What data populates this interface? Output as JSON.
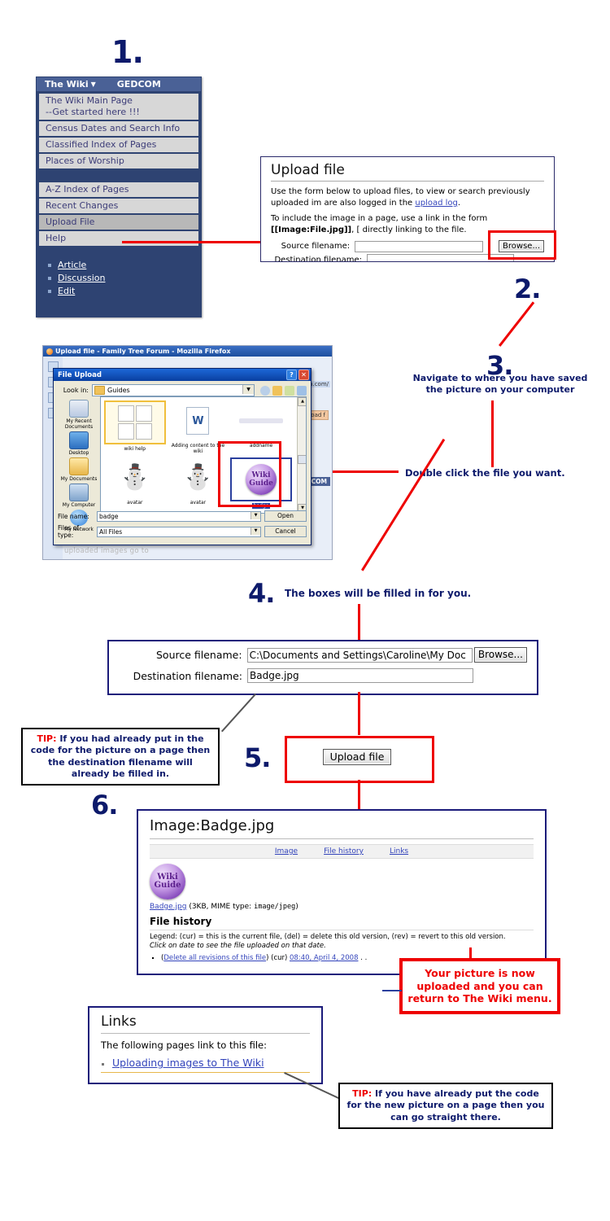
{
  "steps": {
    "one": "1.",
    "two": "2.",
    "three": "3.",
    "four": "4.",
    "five": "5.",
    "six": "6."
  },
  "annotations": {
    "navigate": "Navigate to where you have saved\nthe picture on your computer",
    "double_click": "Double click the file you want.",
    "boxes_filled": "The boxes will be filled in for you."
  },
  "wiki_menu": {
    "header_title": "The Wiki",
    "header_caret": "▼",
    "header_right": "GEDCOM",
    "items": [
      {
        "label": "The Wiki Main Page\n--Get started here !!!",
        "highlighted": false
      },
      {
        "label": "Census Dates and Search Info",
        "highlighted": false
      },
      {
        "label": "Classified Index of Pages",
        "highlighted": false
      },
      {
        "label": "Places of Worship",
        "highlighted": false
      },
      {
        "label": "",
        "highlighted": false,
        "blank": true
      },
      {
        "label": "A-Z Index of Pages",
        "highlighted": false
      },
      {
        "label": "Recent Changes",
        "highlighted": false
      },
      {
        "label": "Upload File",
        "highlighted": true
      },
      {
        "label": "Help",
        "highlighted": false
      }
    ],
    "sub_links": [
      "Article",
      "Discussion",
      "Edit"
    ]
  },
  "upload_form": {
    "title": "Upload file",
    "intro_line1": "Use the form below to upload files, to view or search previously uploaded im",
    "intro_line2_pre": "are also logged in the ",
    "intro_link": "upload log",
    "intro_line2_post": ".",
    "include_line1_pre": "To include the image in a page, use a link in the form ",
    "include_code": "[[Image:File.jpg]]",
    "include_line1_post": ", [",
    "include_line2": "directly linking to the file.",
    "source_label": "Source filename:",
    "source_value": "",
    "dest_label": "Destination filename:",
    "dest_value": "",
    "browse_label": "Browse..."
  },
  "firefox_window": {
    "title": "Upload file - Family Tree Forum - Mozilla Firefox",
    "url_fragment": "orum.com/",
    "tab_label": "Upload f",
    "gedcom_label": "DCOM",
    "page_text": "Use the form below to upload files, to view or search previously uploaded images go to"
  },
  "file_dialog": {
    "title": "File Upload",
    "help_btn": "?",
    "close_btn": "✕",
    "look_in_label": "Look in:",
    "look_in_value": "Guides",
    "places": [
      "My Recent Documents",
      "Desktop",
      "My Documents",
      "My Computer",
      "My Network"
    ],
    "files": [
      {
        "name": "wiki help",
        "kind": "doc-pages",
        "selected": true
      },
      {
        "name": "Adding content to the wiki",
        "kind": "word-doc",
        "selected": false
      },
      {
        "name": "addname",
        "kind": "faint-image",
        "selected": false
      },
      {
        "name": "avatar",
        "kind": "snowman",
        "selected": false
      },
      {
        "name": "avatar",
        "kind": "snowman",
        "selected": false
      },
      {
        "name": "badge",
        "kind": "wiki-badge",
        "selected": false,
        "highlighted": true
      }
    ],
    "badge_text_line1": "Wiki",
    "badge_text_line2": "Guide",
    "file_name_label": "File name:",
    "file_name_value": "badge",
    "files_of_type_label": "Files of type:",
    "files_of_type_value": "All Files",
    "open_button": "Open",
    "cancel_button": "Cancel"
  },
  "filled_form": {
    "source_label": "Source filename:",
    "source_value": "C:\\Documents and Settings\\Caroline\\My Doc",
    "dest_label": "Destination filename:",
    "dest_value": "Badge.jpg",
    "browse_label": "Browse..."
  },
  "upload_button": {
    "label": "Upload file"
  },
  "tips": {
    "tip1_keyword": "TIP:",
    "tip1_text": " If you had already put in the code for the picture on a page then the destination filename will already be filled in.",
    "tip2_keyword": "TIP:",
    "tip2_text": " If you have already put the code for the new picture on a page then you can go straight there.",
    "success": "Your picture is now uploaded and  you can return to The Wiki menu."
  },
  "image_page": {
    "title": "Image:Badge.jpg",
    "tabs": [
      "Image",
      "File history",
      "Links"
    ],
    "file_link": "Badge.jpg",
    "file_meta_pre": " (3KB, MIME type: ",
    "file_mime": "image/jpeg",
    "file_meta_post": ")",
    "history_heading": "File history",
    "legend_line1": "Legend: (cur) = this is the current file, (del) = delete this old version, (rev) = revert to this old version.",
    "legend_line2": "Click on date to see the file uploaded on that date.",
    "revision_delete_link": "Delete all revisions of this file",
    "revision_cur": "(cur)",
    "revision_date": "08:40, April 4, 2008",
    "revision_trailing": ". .",
    "badge_line1": "Wiki",
    "badge_line2": "Guide"
  },
  "links_page": {
    "title": "Links",
    "intro": "The following pages link to this file:",
    "links": [
      "Uploading images to The Wiki"
    ]
  },
  "colors": {
    "menu_header": "#4a6196",
    "menu_bg": "#2e4372",
    "annotation_navy": "#0d1a6b",
    "marker_red": "#ee0000",
    "link_blue": "#3344bb"
  }
}
